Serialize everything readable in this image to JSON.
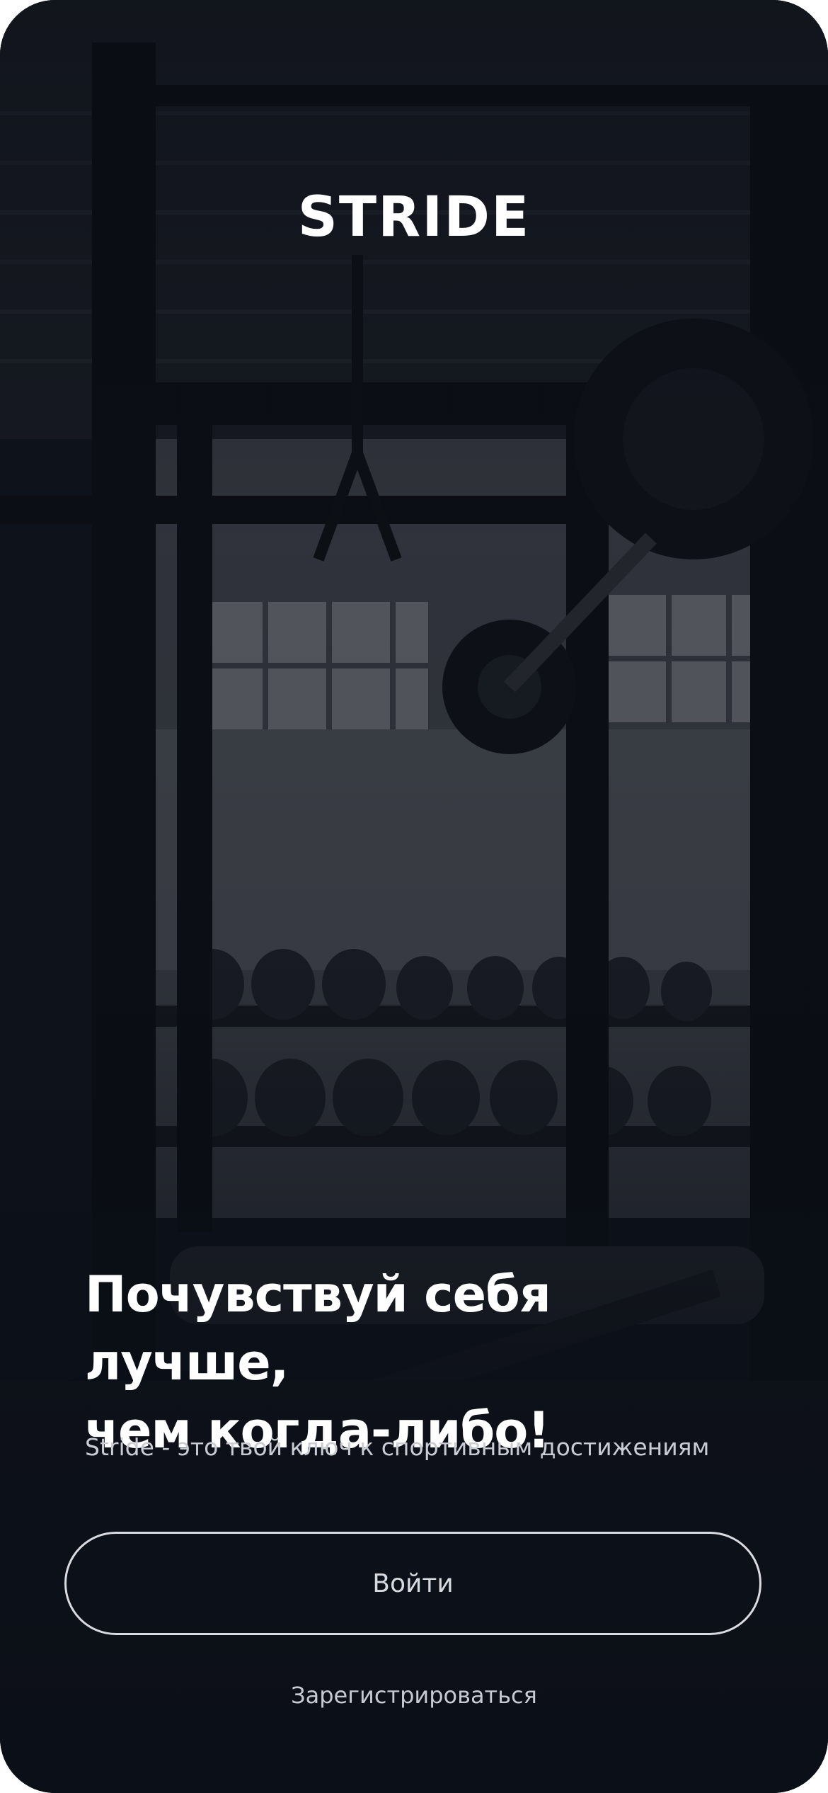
{
  "app": {
    "logo_text": "STRIDE"
  },
  "hero": {
    "headline_line1": "Почувствуй себя лучше,",
    "headline_line2": "чем когда-либо!",
    "subtitle": "Stride - это твой ключ к спортивным достижениям"
  },
  "actions": {
    "login_label": "Войти",
    "register_label": "Зарегистрироваться"
  },
  "colors": {
    "background": "#0c1018",
    "text_primary": "#ffffff",
    "text_secondary": "#c9ccd3",
    "button_border": "#d9dbe0"
  }
}
